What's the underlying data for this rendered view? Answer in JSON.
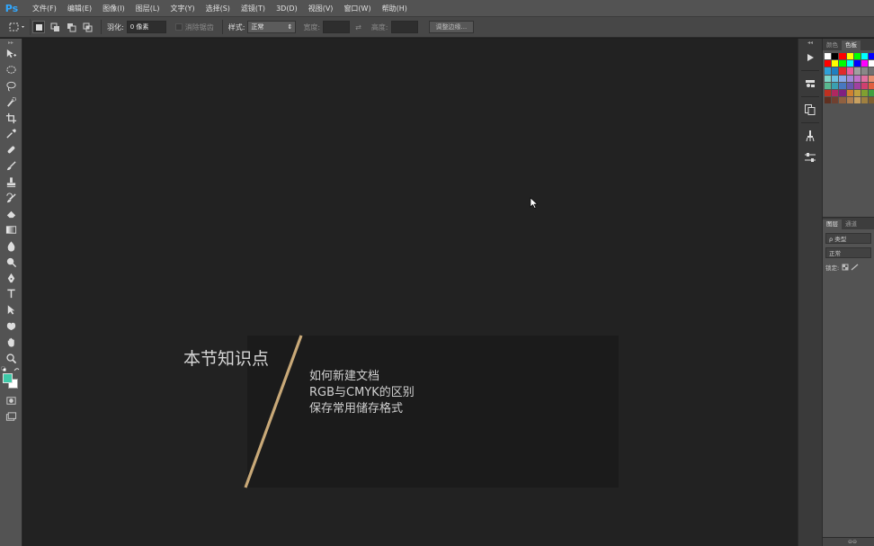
{
  "app": {
    "logo": "Ps"
  },
  "menu": [
    "文件(F)",
    "编辑(E)",
    "图像(I)",
    "图层(L)",
    "文字(Y)",
    "选择(S)",
    "滤镜(T)",
    "3D(D)",
    "视图(V)",
    "窗口(W)",
    "帮助(H)"
  ],
  "options": {
    "feather_label": "羽化:",
    "feather_value": "0 像素",
    "antialias_label": "消除锯齿",
    "style_label": "样式:",
    "style_value": "正常",
    "width_label": "宽度:",
    "height_label": "高度:",
    "refine_button": "调整边缘..."
  },
  "colors": {
    "foreground": "#3ec9a8",
    "background": "#ffffff",
    "accent_line": "#c9a978"
  },
  "slide": {
    "title": "本节知识点",
    "items": [
      "如何新建文档",
      "RGB与CMYK的区别",
      "保存常用储存格式"
    ]
  },
  "panels": {
    "swatch_tabs": [
      "颜色",
      "色板"
    ],
    "layers_tabs": [
      "图层",
      "通道"
    ],
    "layers_filter": "ρ 类型",
    "blend_mode": "正常",
    "lock_label": "锁定:",
    "footer": "⊖⊖"
  },
  "swatches": [
    "#ffffff",
    "#000000",
    "#ff0000",
    "#ffff00",
    "#00ff00",
    "#00ffff",
    "#0000ff",
    "#ff0000",
    "#ffff00",
    "#00ff00",
    "#00ffff",
    "#0000ff",
    "#ff00ff",
    "#ffffff",
    "#2ea0d8",
    "#1f7fc0",
    "#e12a2a",
    "#e95c9c",
    "#a0a0a0",
    "#888888",
    "#707070",
    "#7fd6c8",
    "#6ac0e0",
    "#88a8e8",
    "#a088d8",
    "#c070c8",
    "#e070a0",
    "#e89070",
    "#58b890",
    "#3aa0b0",
    "#4878c0",
    "#6858b0",
    "#a040a0",
    "#d04070",
    "#e06040",
    "#c03020",
    "#b02860",
    "#802080",
    "#d08030",
    "#c0a040",
    "#80a030",
    "#40a040",
    "#603020",
    "#704030",
    "#906040",
    "#b08050",
    "#c8a060",
    "#a08040",
    "#806030"
  ]
}
